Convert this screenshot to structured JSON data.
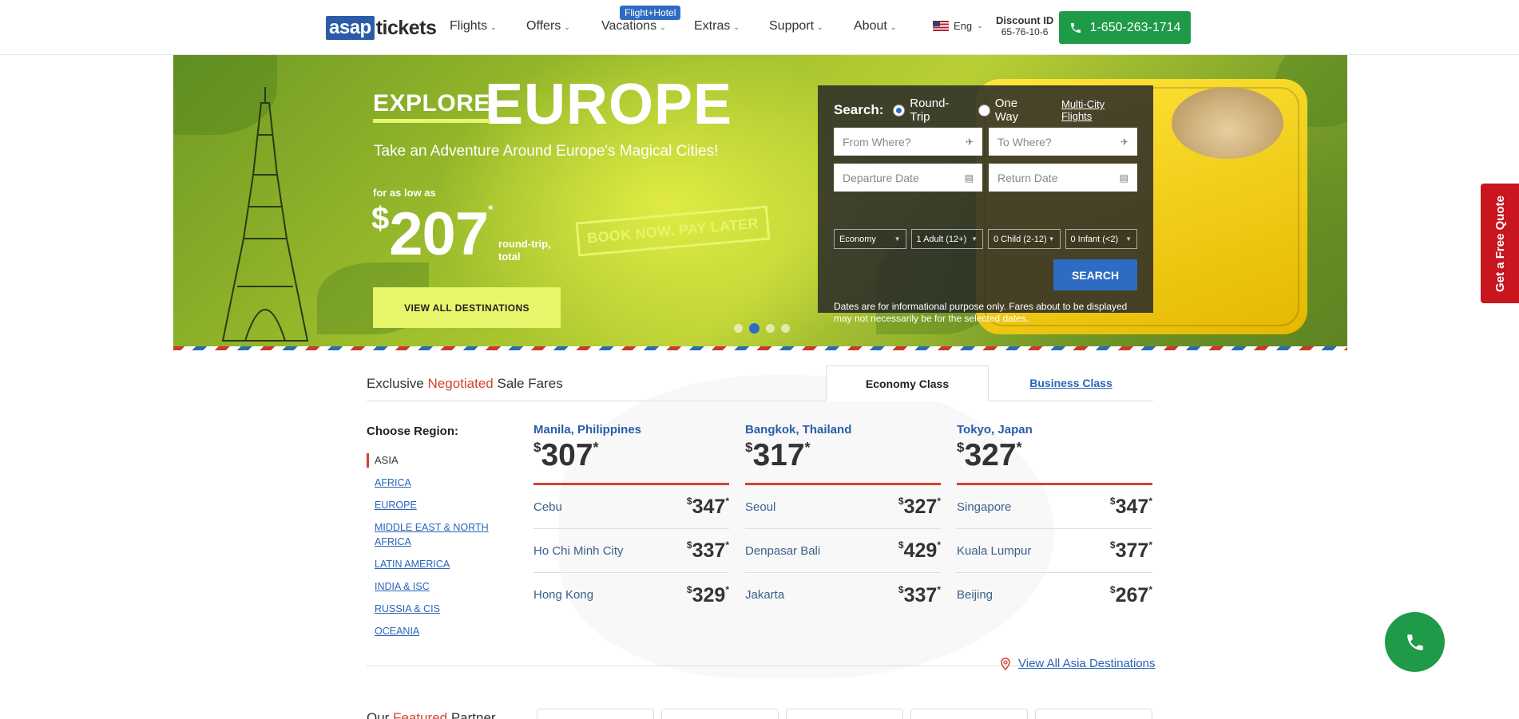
{
  "header": {
    "logo_box": "asap",
    "logo_rest": "tickets",
    "nav": [
      {
        "label": "Flights"
      },
      {
        "label": "Offers"
      },
      {
        "label": "Vacations"
      },
      {
        "label": "Extras"
      },
      {
        "label": "Support"
      },
      {
        "label": "About"
      }
    ],
    "vacations_badge": "Flight+Hotel",
    "language": "Eng",
    "discount_label": "Discount ID",
    "discount_value": "65-76-10-6",
    "phone": "1-650-263-1714"
  },
  "hero": {
    "explore": "EXPLORE",
    "destination": "EUROPE",
    "tagline": "Take an Adventure Around Europe's Magical Cities!",
    "low_as": "for as low as",
    "currency": "$",
    "price": "207",
    "price_star": "*",
    "price_note_1": "round-trip,",
    "price_note_2": "total",
    "stamp": "BOOK NOW. PAY LATER",
    "cta": "VIEW ALL DESTINATIONS",
    "slides": 4,
    "active_slide": 2
  },
  "search": {
    "label": "Search:",
    "round_trip": "Round-Trip",
    "one_way": "One Way",
    "selected_trip": "Round-Trip",
    "multi_city": "Multi-City Flights",
    "from_placeholder": "From Where?",
    "to_placeholder": "To Where?",
    "departure_placeholder": "Departure Date",
    "return_placeholder": "Return Date",
    "cabin": "Economy",
    "adults": "1 Adult (12+)",
    "children": "0 Child (2-12)",
    "infants": "0 Infant (<2)",
    "button": "SEARCH",
    "note": "Dates are for informational purpose only. Fares about to be displayed may not necessarily be for the selected dates."
  },
  "quote_tab": "Get a Free Quote",
  "fares": {
    "title_pre": "Exclusive ",
    "title_accent": "Negotiated",
    "title_post": " Sale Fares",
    "tab_active": "Economy Class",
    "tab_other": "Business Class",
    "choose_region": "Choose Region:",
    "regions": [
      "ASIA",
      "AFRICA",
      "EUROPE",
      "MIDDLE EAST & NORTH AFRICA",
      "LATIN AMERICA",
      "INDIA & ISC",
      "RUSSIA & CIS",
      "OCEANIA"
    ],
    "active_region": "ASIA",
    "columns": [
      {
        "city": "Manila, Philippines",
        "price": "307",
        "rows": [
          {
            "city": "Cebu",
            "price": "347"
          },
          {
            "city": "Ho Chi Minh City",
            "price": "337"
          },
          {
            "city": "Hong Kong",
            "price": "329"
          }
        ]
      },
      {
        "city": "Bangkok, Thailand",
        "price": "317",
        "rows": [
          {
            "city": "Seoul",
            "price": "327"
          },
          {
            "city": "Denpasar Bali",
            "price": "429"
          },
          {
            "city": "Jakarta",
            "price": "337"
          }
        ]
      },
      {
        "city": "Tokyo, Japan",
        "price": "327",
        "rows": [
          {
            "city": "Singapore",
            "price": "347"
          },
          {
            "city": "Kuala Lumpur",
            "price": "377"
          },
          {
            "city": "Beijing",
            "price": "267"
          }
        ]
      }
    ],
    "currency": "$",
    "star": "*",
    "view_all": "View All Asia Destinations"
  },
  "partner": {
    "pre": "Our ",
    "accent": "Featured",
    "post": " Partner"
  },
  "colors": {
    "brand_blue": "#2a5ca8",
    "link_blue": "#2a64b8",
    "accent_red": "#d0452e",
    "call_green": "#1f9a49",
    "lime": "#e7f56a",
    "quote_red": "#c8151e"
  }
}
